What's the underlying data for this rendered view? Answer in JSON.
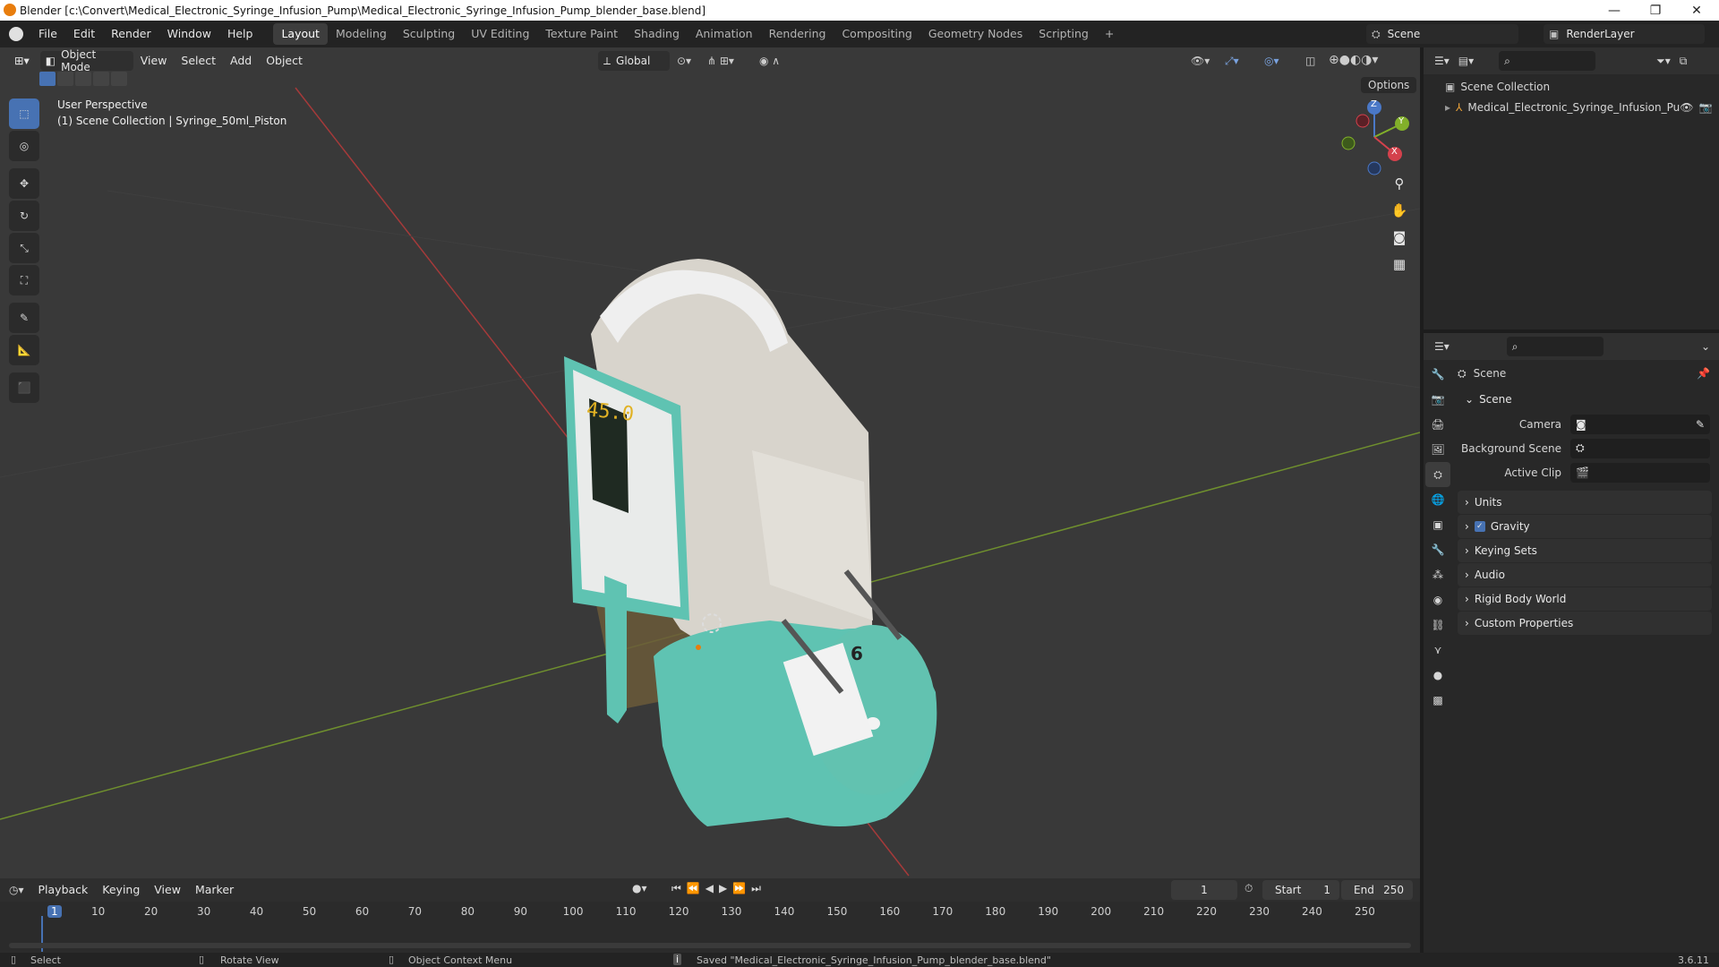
{
  "window": {
    "title": "Blender [c:\\Convert\\Medical_Electronic_Syringe_Infusion_Pump\\Medical_Electronic_Syringe_Infusion_Pump_blender_base.blend]",
    "minimize": "—",
    "maximize": "❐",
    "close": "✕"
  },
  "menus": [
    "File",
    "Edit",
    "Render",
    "Window",
    "Help"
  ],
  "workspaces": [
    "Layout",
    "Modeling",
    "Sculpting",
    "UV Editing",
    "Texture Paint",
    "Shading",
    "Animation",
    "Rendering",
    "Compositing",
    "Geometry Nodes",
    "Scripting"
  ],
  "active_workspace": "Layout",
  "add_workspace": "+",
  "scene_field": "Scene",
  "renderlayer_field": "RenderLayer",
  "viewport": {
    "mode": "Object Mode",
    "menu": [
      "View",
      "Select",
      "Add",
      "Object"
    ],
    "transform_orientation": "Global",
    "options": "Options",
    "overlay_title": "User Perspective",
    "overlay_subtitle": "(1) Scene Collection | Syringe_50ml_Piston",
    "gizmo": {
      "x": "X",
      "y": "Y",
      "z": "Z"
    },
    "device_screen_value": "45.0",
    "syringe_label": "6"
  },
  "outliner": {
    "root": "Scene Collection",
    "item": "Medical_Electronic_Syringe_Infusion_Pu"
  },
  "properties": {
    "header": "Scene",
    "section": "Scene",
    "fields": [
      {
        "label": "Camera",
        "value": ""
      },
      {
        "label": "Background Scene",
        "value": ""
      },
      {
        "label": "Active Clip",
        "value": ""
      }
    ],
    "panels": [
      "Units",
      "Gravity",
      "Keying Sets",
      "Audio",
      "Rigid Body World",
      "Custom Properties"
    ],
    "gravity_checked": true
  },
  "timeline": {
    "menus": [
      "Playback",
      "Keying",
      "View",
      "Marker"
    ],
    "current_frame": "1",
    "start_label": "Start",
    "start": "1",
    "end_label": "End",
    "end": "250",
    "ticks": [
      "1",
      "10",
      "20",
      "30",
      "40",
      "50",
      "60",
      "70",
      "80",
      "90",
      "100",
      "110",
      "120",
      "130",
      "140",
      "150",
      "160",
      "170",
      "180",
      "190",
      "200",
      "210",
      "220",
      "230",
      "240",
      "250"
    ]
  },
  "status": {
    "select": "Select",
    "rotate": "Rotate View",
    "context": "Object Context Menu",
    "message": "Saved \"Medical_Electronic_Syringe_Infusion_Pump_blender_base.blend\"",
    "version": "3.6.11"
  },
  "colors": {
    "accent": "#4772b3",
    "x_axis": "#a53a3a",
    "y_axis": "#6f8f2e",
    "teal": "#5fc3b2"
  }
}
